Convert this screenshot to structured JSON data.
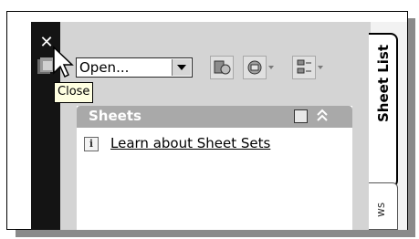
{
  "palette": {
    "panel_bar": "#141414",
    "toolbar_bg": "#d4d4d4",
    "panel_header_bg": "#a9a9a9",
    "tooltip_bg": "#ffffe1"
  },
  "close_icon": {
    "glyph": "✕",
    "tooltip": "Close"
  },
  "toolbar": {
    "sheet_combo_value": "Open...",
    "buttons": [
      {
        "name": "publish-button",
        "icon": "publish-icon"
      },
      {
        "name": "plot-button",
        "icon": "plot-icon"
      },
      {
        "name": "view-options-button",
        "icon": "view-options-icon"
      }
    ]
  },
  "sheets_panel": {
    "title": "Sheets",
    "link_text": "Learn about Sheet Sets"
  },
  "tabs": {
    "active": "Sheet List",
    "partial": "ws"
  }
}
